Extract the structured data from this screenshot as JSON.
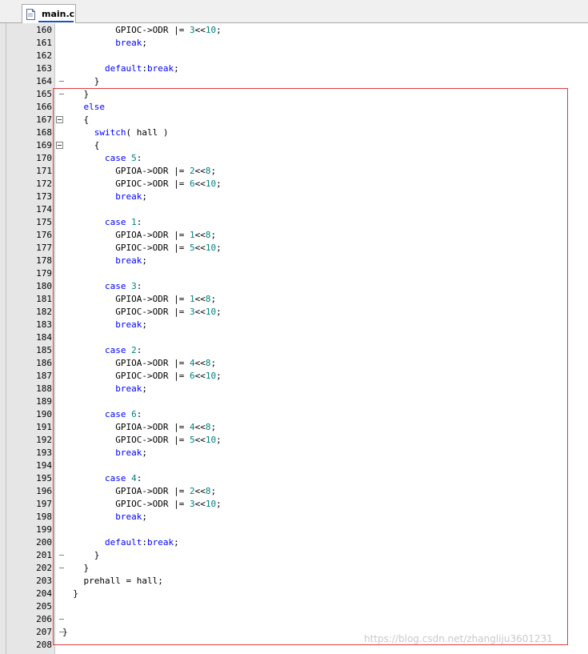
{
  "tab": {
    "label": "main.c",
    "icon": "c-file-icon"
  },
  "colors": {
    "keyword": "#0000ff",
    "number": "#008080",
    "text": "#000000",
    "highlight_box": "#e03c3c"
  },
  "watermark": "https://blog.csdn.net/zhangliju3601231",
  "lines": [
    {
      "n": "160",
      "tokens": [
        [
          "t",
          "          GPIOC->ODR |= "
        ],
        [
          "n",
          "3"
        ],
        [
          "t",
          "<<"
        ],
        [
          "n",
          "10"
        ],
        [
          "t",
          ";"
        ]
      ]
    },
    {
      "n": "161",
      "tokens": [
        [
          "t",
          "          "
        ],
        [
          "k",
          "break"
        ],
        [
          "t",
          ";"
        ]
      ]
    },
    {
      "n": "162",
      "tokens": []
    },
    {
      "n": "163",
      "tokens": [
        [
          "t",
          "        "
        ],
        [
          "k",
          "default"
        ],
        [
          "t",
          ":"
        ],
        [
          "k",
          "break"
        ],
        [
          "t",
          ";"
        ]
      ]
    },
    {
      "n": "164",
      "tokens": [
        [
          "t",
          "      }"
        ]
      ],
      "fold": "end"
    },
    {
      "n": "165",
      "tokens": [
        [
          "t",
          "    }"
        ]
      ],
      "fold": "end"
    },
    {
      "n": "166",
      "tokens": [
        [
          "t",
          "    "
        ],
        [
          "k",
          "else"
        ]
      ]
    },
    {
      "n": "167",
      "tokens": [
        [
          "t",
          "    {"
        ]
      ],
      "fold": "start"
    },
    {
      "n": "168",
      "tokens": [
        [
          "t",
          "      "
        ],
        [
          "k",
          "switch"
        ],
        [
          "t",
          "( hall )"
        ]
      ]
    },
    {
      "n": "169",
      "tokens": [
        [
          "t",
          "      {"
        ]
      ],
      "fold": "start"
    },
    {
      "n": "170",
      "tokens": [
        [
          "t",
          "        "
        ],
        [
          "k",
          "case"
        ],
        [
          "t",
          " "
        ],
        [
          "n",
          "5"
        ],
        [
          "t",
          ":"
        ]
      ]
    },
    {
      "n": "171",
      "tokens": [
        [
          "t",
          "          GPIOA->ODR |= "
        ],
        [
          "n",
          "2"
        ],
        [
          "t",
          "<<"
        ],
        [
          "n",
          "8"
        ],
        [
          "t",
          ";"
        ]
      ]
    },
    {
      "n": "172",
      "tokens": [
        [
          "t",
          "          GPIOC->ODR |= "
        ],
        [
          "n",
          "6"
        ],
        [
          "t",
          "<<"
        ],
        [
          "n",
          "10"
        ],
        [
          "t",
          ";"
        ]
      ]
    },
    {
      "n": "173",
      "tokens": [
        [
          "t",
          "          "
        ],
        [
          "k",
          "break"
        ],
        [
          "t",
          ";"
        ]
      ]
    },
    {
      "n": "174",
      "tokens": []
    },
    {
      "n": "175",
      "tokens": [
        [
          "t",
          "        "
        ],
        [
          "k",
          "case"
        ],
        [
          "t",
          " "
        ],
        [
          "n",
          "1"
        ],
        [
          "t",
          ":"
        ]
      ]
    },
    {
      "n": "176",
      "tokens": [
        [
          "t",
          "          GPIOA->ODR |= "
        ],
        [
          "n",
          "1"
        ],
        [
          "t",
          "<<"
        ],
        [
          "n",
          "8"
        ],
        [
          "t",
          ";"
        ]
      ]
    },
    {
      "n": "177",
      "tokens": [
        [
          "t",
          "          GPIOC->ODR |= "
        ],
        [
          "n",
          "5"
        ],
        [
          "t",
          "<<"
        ],
        [
          "n",
          "10"
        ],
        [
          "t",
          ";"
        ]
      ]
    },
    {
      "n": "178",
      "tokens": [
        [
          "t",
          "          "
        ],
        [
          "k",
          "break"
        ],
        [
          "t",
          ";"
        ]
      ]
    },
    {
      "n": "179",
      "tokens": []
    },
    {
      "n": "180",
      "tokens": [
        [
          "t",
          "        "
        ],
        [
          "k",
          "case"
        ],
        [
          "t",
          " "
        ],
        [
          "n",
          "3"
        ],
        [
          "t",
          ":"
        ]
      ]
    },
    {
      "n": "181",
      "tokens": [
        [
          "t",
          "          GPIOA->ODR |= "
        ],
        [
          "n",
          "1"
        ],
        [
          "t",
          "<<"
        ],
        [
          "n",
          "8"
        ],
        [
          "t",
          ";"
        ]
      ]
    },
    {
      "n": "182",
      "tokens": [
        [
          "t",
          "          GPIOC->ODR |= "
        ],
        [
          "n",
          "3"
        ],
        [
          "t",
          "<<"
        ],
        [
          "n",
          "10"
        ],
        [
          "t",
          ";"
        ]
      ]
    },
    {
      "n": "183",
      "tokens": [
        [
          "t",
          "          "
        ],
        [
          "k",
          "break"
        ],
        [
          "t",
          ";"
        ]
      ]
    },
    {
      "n": "184",
      "tokens": []
    },
    {
      "n": "185",
      "tokens": [
        [
          "t",
          "        "
        ],
        [
          "k",
          "case"
        ],
        [
          "t",
          " "
        ],
        [
          "n",
          "2"
        ],
        [
          "t",
          ":"
        ]
      ]
    },
    {
      "n": "186",
      "tokens": [
        [
          "t",
          "          GPIOA->ODR |= "
        ],
        [
          "n",
          "4"
        ],
        [
          "t",
          "<<"
        ],
        [
          "n",
          "8"
        ],
        [
          "t",
          ";"
        ]
      ]
    },
    {
      "n": "187",
      "tokens": [
        [
          "t",
          "          GPIOC->ODR |= "
        ],
        [
          "n",
          "6"
        ],
        [
          "t",
          "<<"
        ],
        [
          "n",
          "10"
        ],
        [
          "t",
          ";"
        ]
      ]
    },
    {
      "n": "188",
      "tokens": [
        [
          "t",
          "          "
        ],
        [
          "k",
          "break"
        ],
        [
          "t",
          ";"
        ]
      ]
    },
    {
      "n": "189",
      "tokens": []
    },
    {
      "n": "190",
      "tokens": [
        [
          "t",
          "        "
        ],
        [
          "k",
          "case"
        ],
        [
          "t",
          " "
        ],
        [
          "n",
          "6"
        ],
        [
          "t",
          ":"
        ]
      ]
    },
    {
      "n": "191",
      "tokens": [
        [
          "t",
          "          GPIOA->ODR |= "
        ],
        [
          "n",
          "4"
        ],
        [
          "t",
          "<<"
        ],
        [
          "n",
          "8"
        ],
        [
          "t",
          ";"
        ]
      ]
    },
    {
      "n": "192",
      "tokens": [
        [
          "t",
          "          GPIOC->ODR |= "
        ],
        [
          "n",
          "5"
        ],
        [
          "t",
          "<<"
        ],
        [
          "n",
          "10"
        ],
        [
          "t",
          ";"
        ]
      ]
    },
    {
      "n": "193",
      "tokens": [
        [
          "t",
          "          "
        ],
        [
          "k",
          "break"
        ],
        [
          "t",
          ";"
        ]
      ]
    },
    {
      "n": "194",
      "tokens": []
    },
    {
      "n": "195",
      "tokens": [
        [
          "t",
          "        "
        ],
        [
          "k",
          "case"
        ],
        [
          "t",
          " "
        ],
        [
          "n",
          "4"
        ],
        [
          "t",
          ":"
        ]
      ]
    },
    {
      "n": "196",
      "tokens": [
        [
          "t",
          "          GPIOA->ODR |= "
        ],
        [
          "n",
          "2"
        ],
        [
          "t",
          "<<"
        ],
        [
          "n",
          "8"
        ],
        [
          "t",
          ";"
        ]
      ]
    },
    {
      "n": "197",
      "tokens": [
        [
          "t",
          "          GPIOC->ODR |= "
        ],
        [
          "n",
          "3"
        ],
        [
          "t",
          "<<"
        ],
        [
          "n",
          "10"
        ],
        [
          "t",
          ";"
        ]
      ]
    },
    {
      "n": "198",
      "tokens": [
        [
          "t",
          "          "
        ],
        [
          "k",
          "break"
        ],
        [
          "t",
          ";"
        ]
      ]
    },
    {
      "n": "199",
      "tokens": []
    },
    {
      "n": "200",
      "tokens": [
        [
          "t",
          "        "
        ],
        [
          "k",
          "default"
        ],
        [
          "t",
          ":"
        ],
        [
          "k",
          "break"
        ],
        [
          "t",
          ";"
        ]
      ]
    },
    {
      "n": "201",
      "tokens": [
        [
          "t",
          "      }"
        ]
      ],
      "fold": "end"
    },
    {
      "n": "202",
      "tokens": [
        [
          "t",
          "    }"
        ]
      ],
      "fold": "end"
    },
    {
      "n": "203",
      "tokens": [
        [
          "t",
          "    prehall = hall;"
        ]
      ]
    },
    {
      "n": "204",
      "tokens": [
        [
          "t",
          "  }"
        ]
      ]
    },
    {
      "n": "205",
      "tokens": []
    },
    {
      "n": "206",
      "tokens": [],
      "fold": "end"
    },
    {
      "n": "207",
      "tokens": [
        [
          "t",
          "}"
        ]
      ],
      "fold": "end"
    },
    {
      "n": "208",
      "tokens": []
    }
  ]
}
